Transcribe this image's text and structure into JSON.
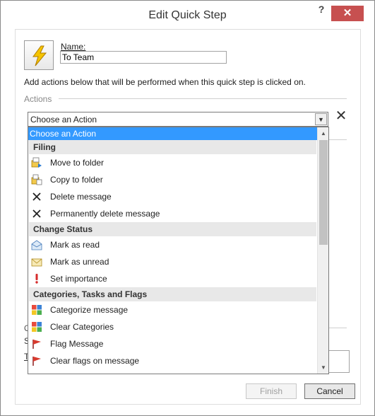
{
  "window": {
    "title": "Edit Quick Step",
    "help_glyph": "?",
    "close_glyph": "✕"
  },
  "quick_step": {
    "icon": "lightning-icon",
    "name_label": "Name:",
    "name_value": "To Team",
    "instructions": "Add actions below that will be performed when this quick step is clicked on."
  },
  "actions": {
    "section_label": "Actions",
    "combo_value": "Choose an Action",
    "remove_glyph": "✕"
  },
  "background": {
    "partial_o": "O",
    "partial_s": "S",
    "partial_t": "T"
  },
  "dropdown": {
    "selected": "Choose an Action",
    "groups": [
      {
        "header": "Filing",
        "items": [
          {
            "label": "Move to folder",
            "icon": "move-to-folder-icon"
          },
          {
            "label": "Copy to folder",
            "icon": "copy-to-folder-icon"
          },
          {
            "label": "Delete message",
            "icon": "delete-icon"
          },
          {
            "label": "Permanently delete message",
            "icon": "delete-icon"
          }
        ]
      },
      {
        "header": "Change Status",
        "items": [
          {
            "label": "Mark as read",
            "icon": "mark-read-icon"
          },
          {
            "label": "Mark as unread",
            "icon": "mark-unread-icon"
          },
          {
            "label": "Set importance",
            "icon": "importance-icon"
          }
        ]
      },
      {
        "header": "Categories, Tasks and Flags",
        "items": [
          {
            "label": "Categorize message",
            "icon": "categorize-icon"
          },
          {
            "label": "Clear Categories",
            "icon": "categorize-icon"
          },
          {
            "label": "Flag Message",
            "icon": "flag-icon"
          },
          {
            "label": "Clear flags on message",
            "icon": "flag-icon"
          }
        ]
      }
    ]
  },
  "buttons": {
    "finish": "Finish",
    "cancel": "Cancel"
  },
  "colors": {
    "selection": "#3399ff",
    "close_button": "#c75050",
    "lightning": "#f5c400"
  }
}
